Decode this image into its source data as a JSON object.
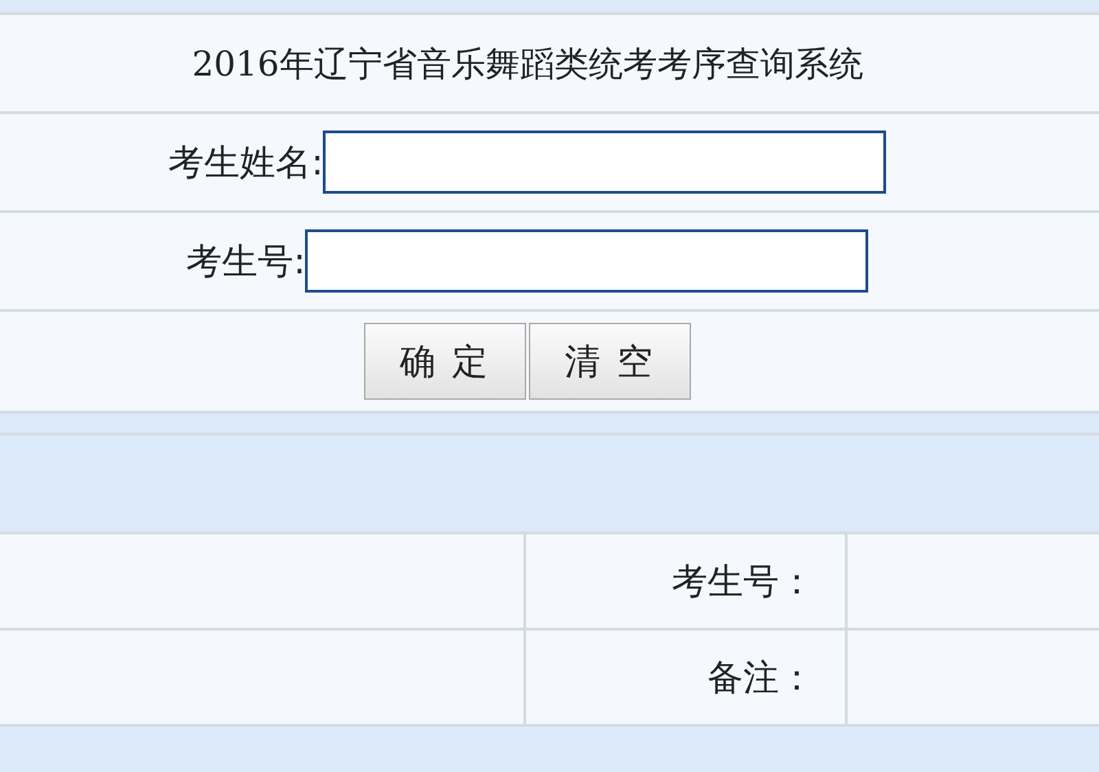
{
  "title": "2016年辽宁省音乐舞蹈类统考考序查询系统",
  "fields": [
    {
      "label": "考生姓名:"
    },
    {
      "label": "考生号:"
    }
  ],
  "buttons": [
    "确 定",
    "清 空"
  ],
  "result_rows": [
    {
      "label": "考生号："
    },
    {
      "label": "备注："
    }
  ]
}
